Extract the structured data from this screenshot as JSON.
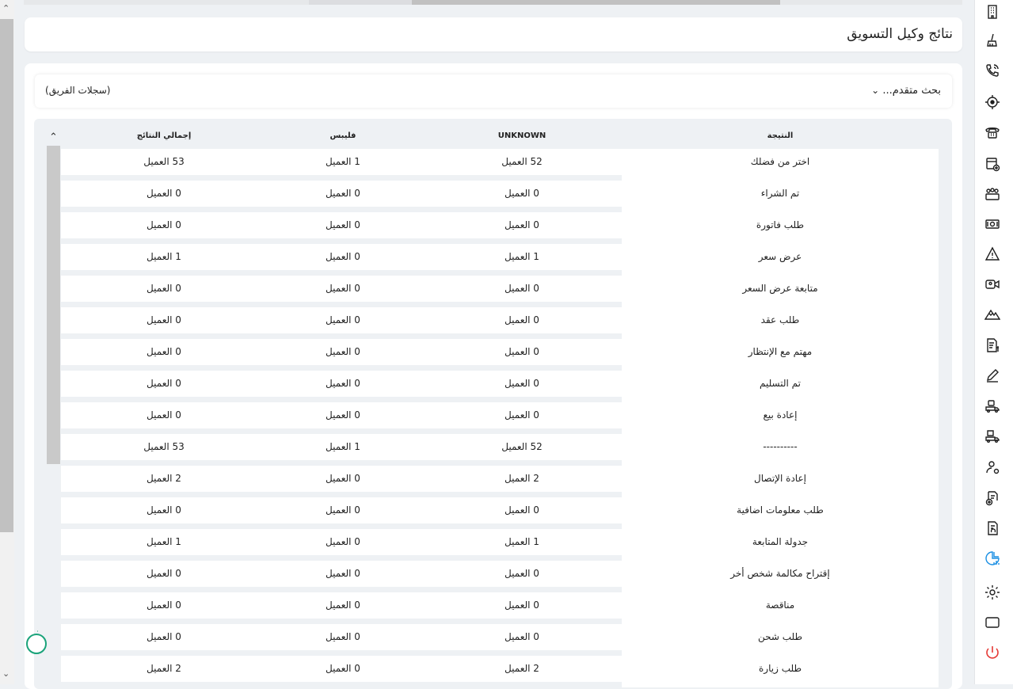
{
  "page": {
    "title": "نتائج وكيل التسويق"
  },
  "search": {
    "advanced_label": "بحث متقدم...",
    "team_label": "(سجلات الفريق)"
  },
  "table": {
    "headers": {
      "result": "النتيجة",
      "unknown": "UNKNOWN",
      "philips": "فليبس",
      "total": "إجمالي النتائج"
    },
    "rows": [
      {
        "result": "اختر من فضلك",
        "unknown": "52 العميل",
        "philips": "1 العميل",
        "total": "53 العميل"
      },
      {
        "result": "تم الشراء",
        "unknown": "0 العميل",
        "philips": "0 العميل",
        "total": "0 العميل"
      },
      {
        "result": "طلب فاتورة",
        "unknown": "0 العميل",
        "philips": "0 العميل",
        "total": "0 العميل"
      },
      {
        "result": "عرض سعر",
        "unknown": "1 العميل",
        "philips": "0 العميل",
        "total": "1 العميل"
      },
      {
        "result": "متابعة عرض السعر",
        "unknown": "0 العميل",
        "philips": "0 العميل",
        "total": "0 العميل"
      },
      {
        "result": "طلب عقد",
        "unknown": "0 العميل",
        "philips": "0 العميل",
        "total": "0 العميل"
      },
      {
        "result": "مهتم مع الإنتظار",
        "unknown": "0 العميل",
        "philips": "0 العميل",
        "total": "0 العميل"
      },
      {
        "result": "تم التسليم",
        "unknown": "0 العميل",
        "philips": "0 العميل",
        "total": "0 العميل"
      },
      {
        "result": "إعادة بيع",
        "unknown": "0 العميل",
        "philips": "0 العميل",
        "total": "0 العميل"
      },
      {
        "result": "----------",
        "unknown": "52 العميل",
        "philips": "1 العميل",
        "total": "53 العميل"
      },
      {
        "result": "إعادة الإتصال",
        "unknown": "2 العميل",
        "philips": "0 العميل",
        "total": "2 العميل"
      },
      {
        "result": "طلب معلومات اضافية",
        "unknown": "0 العميل",
        "philips": "0 العميل",
        "total": "0 العميل"
      },
      {
        "result": "جدولة المتابعة",
        "unknown": "1 العميل",
        "philips": "0 العميل",
        "total": "1 العميل"
      },
      {
        "result": "إقتراح مكالمة شخص أخر",
        "unknown": "0 العميل",
        "philips": "0 العميل",
        "total": "0 العميل"
      },
      {
        "result": "مناقصة",
        "unknown": "0 العميل",
        "philips": "0 العميل",
        "total": "0 العميل"
      },
      {
        "result": "طلب شحن",
        "unknown": "0 العميل",
        "philips": "0 العميل",
        "total": "0 العميل"
      },
      {
        "result": "طلب زيارة",
        "unknown": "2 العميل",
        "philips": "0 العميل",
        "total": "2 العميل"
      }
    ]
  },
  "sidebar_icons": [
    "building-icon",
    "cleaning-icon",
    "phone-call-icon",
    "target-icon",
    "telephone-icon",
    "card-add-icon",
    "team-icon",
    "money-icon",
    "warning-icon",
    "video-call-icon",
    "mountain-icon",
    "invoice-icon",
    "pen-icon",
    "delivery-truck-icon",
    "package-truck-icon",
    "user-settings-icon",
    "document-add-icon",
    "document-refresh-icon",
    "report-chart-icon",
    "settings-icon",
    "window-icon",
    "power-icon"
  ],
  "colors": {
    "accent": "#1a8fe3",
    "power": "#e53935",
    "chat": "#1aa37a"
  }
}
